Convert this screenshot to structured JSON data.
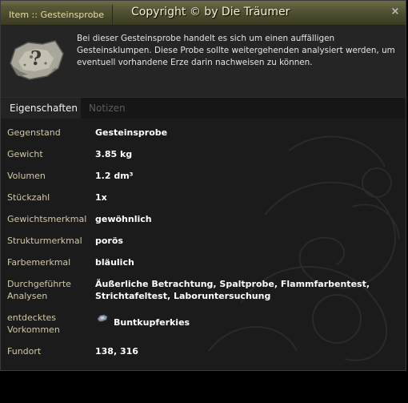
{
  "window": {
    "tab_title": "Item :: Gesteinsprobe",
    "copyright": "Copyright © by Die Träumer",
    "close_symbol": "×"
  },
  "item": {
    "icon": "rock-sample-question-icon",
    "description": "Bei dieser Gesteinsprobe handelt es sich um einen auffälligen Gesteinsklumpen. Diese Probe sollte weitergehenden analysiert werden, um eventuell vorhandene Erze darin nachweisen zu können."
  },
  "tabs": [
    {
      "label": "Eigenschaften",
      "active": true
    },
    {
      "label": "Notizen",
      "active": false
    }
  ],
  "properties": [
    {
      "label": "Gegenstand",
      "value": "Gesteinsprobe"
    },
    {
      "label": "Gewicht",
      "value": "3.85 kg"
    },
    {
      "label": "Volumen",
      "value": "1.2 dm³"
    },
    {
      "label": "Stückzahl",
      "value": "1x"
    },
    {
      "label": "Gewichtsmerkmal",
      "value": "gewöhnlich"
    },
    {
      "label": "Strukturmerkmal",
      "value": "porös"
    },
    {
      "label": "Farbemerkmal",
      "value": "bläulich"
    },
    {
      "label": "Durchgeführte\nAnalysen",
      "value": "Äußerliche Betrachtung, Spaltprobe, Flammfarbentest,\nStrichtafeltest, Laboruntersuchung"
    },
    {
      "label": "entdecktes\nVorkommen",
      "value": "Buntkupferkies",
      "icon": "ore-icon"
    },
    {
      "label": "Fundort",
      "value": "138, 316"
    }
  ],
  "colors": {
    "titlebar": "#5c5c3a",
    "label": "#d2c8a6",
    "value": "#ffffff",
    "inactive_tab": "#5c5c5c"
  }
}
